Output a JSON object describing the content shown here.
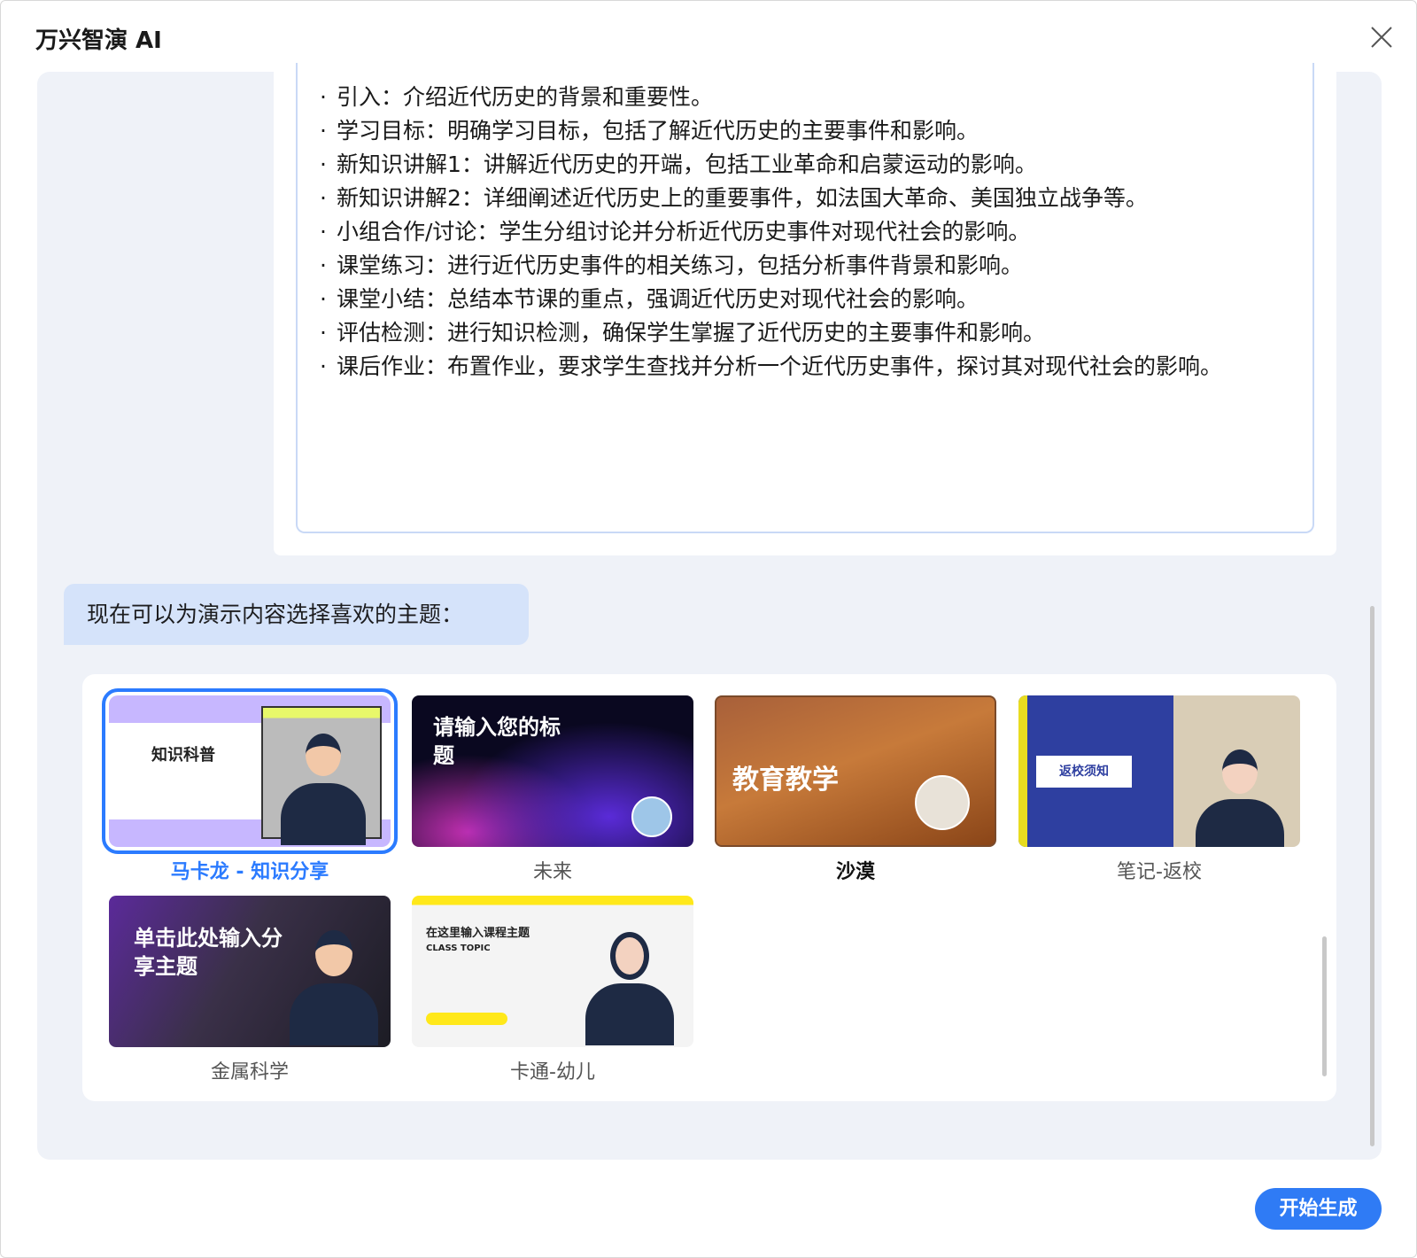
{
  "window": {
    "title": "万兴智演 AI",
    "close_icon": "close-icon"
  },
  "outline": {
    "lines": [
      "引入：介绍近代历史的背景和重要性。",
      "学习目标：明确学习目标，包括了解近代历史的主要事件和影响。",
      "新知识讲解1：讲解近代历史的开端，包括工业革命和启蒙运动的影响。",
      "新知识讲解2：详细阐述近代历史上的重要事件，如法国大革命、美国独立战争等。",
      "小组合作/讨论：学生分组讨论并分析近代历史事件对现代社会的影响。",
      "课堂练习：进行近代历史事件的相关练习，包括分析事件背景和影响。",
      "课堂小结：总结本节课的重点，强调近代历史对现代社会的影响。",
      "评估检测：进行知识检测，确保学生掌握了近代历史的主要事件和影响。",
      "课后作业：布置作业，要求学生查找并分析一个近代历史事件，探讨其对现代社会的影响。"
    ],
    "bullet": "·"
  },
  "prompt": "现在可以为演示内容选择喜欢的主题：",
  "themes": [
    {
      "label": "马卡龙 - 知识分享",
      "thumb_text": "知识科普",
      "selected": true
    },
    {
      "label": "未来",
      "thumb_text": "请输入您的标题"
    },
    {
      "label": "沙漠",
      "thumb_text": "教育教学"
    },
    {
      "label": "笔记-返校",
      "thumb_text": "返校须知"
    },
    {
      "label": "金属科学",
      "thumb_text": "单击此处输入分享主题"
    },
    {
      "label": "卡通-幼儿",
      "thumb_text": "在这里输入课程主题",
      "thumb_sub": "CLASS TOPIC"
    }
  ],
  "actions": {
    "generate": "开始生成"
  },
  "colors": {
    "accent": "#2f7bf5",
    "selected": "#2b7bff",
    "panel": "#eff2f8",
    "bubble": "#d5e3fa"
  }
}
